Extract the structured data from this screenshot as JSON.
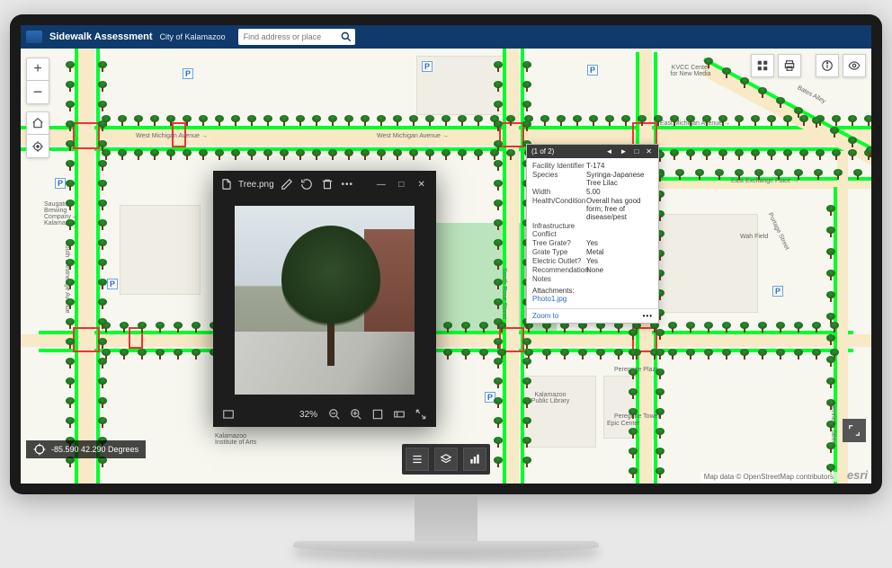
{
  "header": {
    "title": "Sidewalk Assessment",
    "subtitle": "City of Kalamazoo",
    "search_placeholder": "Find address or place"
  },
  "coords": {
    "text": "-85.590 42.290 Degrees"
  },
  "attribution": "Map data © OpenStreetMap contributors",
  "esri": "esri",
  "streets": {
    "w_michigan": "West Michigan Avenue →",
    "e_michigan": "→ East Michigan Avenue →",
    "e_exchange": "East Exchange Place →",
    "s_rose": "South Rose Street",
    "s_westnedge": "South Westnedge Avenue",
    "bates": "Bates Alley",
    "portage": "Portage Street",
    "henrietta": "Henrietta Street",
    "kvcc": "KVCC Center for New Media",
    "peregrine": "Peregrine Plaza",
    "wahfield": "Wah Field",
    "saugatuck": "Saugatuck Brewing Company – Kalamazoo",
    "kpl": "Kalamazoo Public Library",
    "kia": "Kalamazoo Institute of Arts",
    "epic": "Epic Center",
    "peregrine_tower": "Peregrine Tower"
  },
  "popup": {
    "pager": "(1 of 2)",
    "rows": [
      {
        "k": "Facility Identifier",
        "v": "T-174"
      },
      {
        "k": "Species",
        "v": "Syringa-Japanese Tree Lilac"
      },
      {
        "k": "Width",
        "v": "5.00"
      },
      {
        "k": "Health/Condition",
        "v": "Overall has good form; free of disease/pest"
      },
      {
        "k": "Infrastructure Conflict",
        "v": ""
      },
      {
        "k": "Tree Grate?",
        "v": "Yes"
      },
      {
        "k": "Grate Type",
        "v": "Metal"
      },
      {
        "k": "Electric Outlet?",
        "v": "Yes"
      },
      {
        "k": "Recommendation",
        "v": "None"
      },
      {
        "k": "Notes",
        "v": ""
      }
    ],
    "attachments_label": "Attachments:",
    "attachment_link": "Photo1.jpg",
    "zoom_to": "Zoom to"
  },
  "viewer": {
    "filename": "Tree.png",
    "zoom": "32%"
  }
}
